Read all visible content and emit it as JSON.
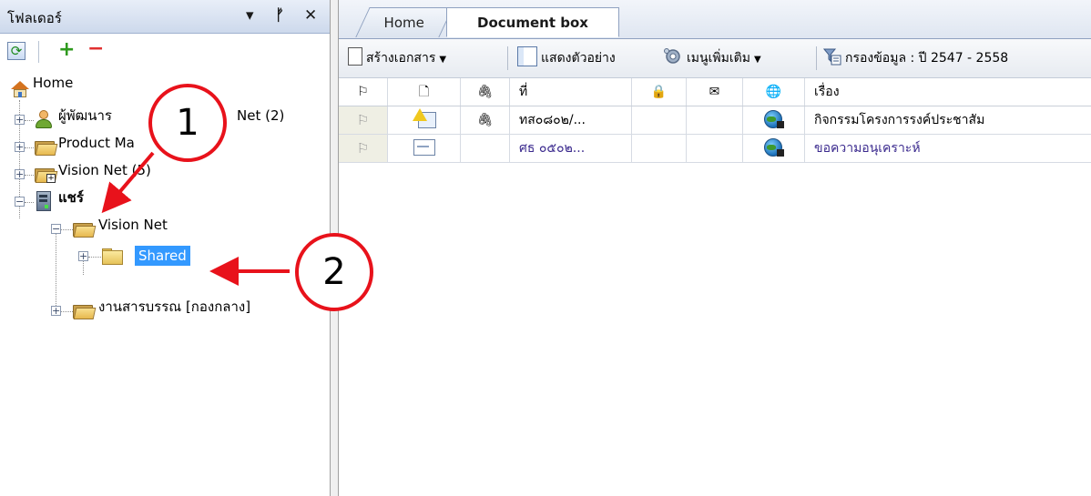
{
  "left_pane": {
    "title": "โฟลเดอร์",
    "controls": {
      "dropdown": "▾",
      "pin": "ᚠ",
      "close": "✕"
    },
    "toolbar": {
      "refresh": "⟳",
      "add": "+",
      "remove": "−"
    },
    "tree": [
      {
        "label": "Home",
        "icon": "home-icon"
      },
      {
        "label": "ผู้พัฒนาระบบ Vision Net (2)",
        "icon": "person-icon",
        "visible_label": "ผู้พัฒนาร",
        "visible_suffix": "Net (2)"
      },
      {
        "label": "Product Ma",
        "icon": "folder-icon"
      },
      {
        "label": "Vision Net (5)",
        "icon": "folder-icon"
      },
      {
        "label": "แชร์",
        "icon": "server-icon"
      },
      {
        "label": "Vision Net",
        "icon": "folder-icon"
      },
      {
        "label": "Shared",
        "icon": "folder-icon"
      },
      {
        "label": "งานสารบรรณ [กองกลาง]",
        "icon": "folder-icon"
      }
    ]
  },
  "right_pane": {
    "tabs": [
      {
        "label": "Home"
      },
      {
        "label": "Document box"
      }
    ],
    "toolbar": {
      "create": "สร้างเอกสาร",
      "preview": "แสดงตัวอย่าง",
      "more_menu": "เมนูเพิ่มเติม",
      "filter": "กรองข้อมูล : ปี 2547 - 2558"
    },
    "grid": {
      "headers": {
        "flag": "⚐",
        "doc": "🗋",
        "attach": "🖇",
        "number": "ที่",
        "lock": "🔒",
        "mail": "✉",
        "web": "🌐",
        "subject": "เรื่อง"
      },
      "rows": [
        {
          "flag": "⚐",
          "attach": "🖇",
          "number": "ทส๐๘๐๒/...",
          "subject": "กิจกรรมโครงการรงค์ประชาสัม"
        },
        {
          "flag": "⚐",
          "attach": "",
          "number": "ศธ ๐๕๐๒...",
          "subject": "ขอความอนุเคราะห์"
        }
      ]
    }
  },
  "annotations": [
    {
      "label": "1"
    },
    {
      "label": "2"
    }
  ],
  "colors": {
    "callout": "#e8121b",
    "selection": "#3399ff",
    "link_text": "#3b2a8e"
  }
}
